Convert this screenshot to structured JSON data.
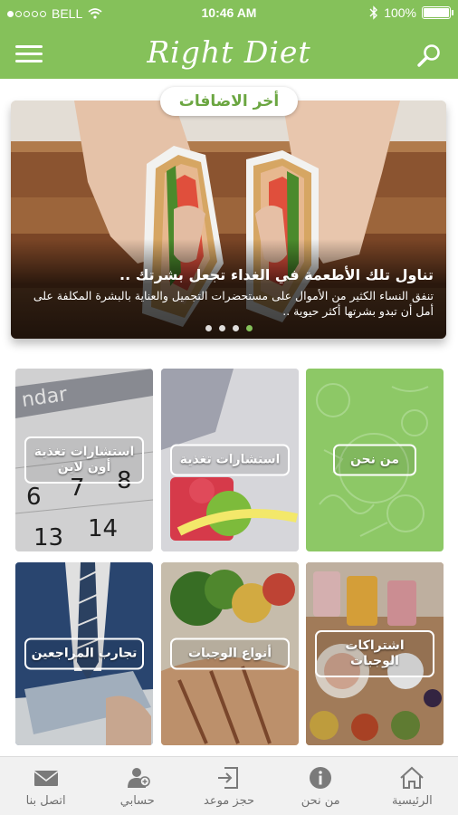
{
  "status_bar": {
    "carrier": "BELL",
    "time": "10:46 AM",
    "battery": "100%",
    "signal_dots_filled": 1,
    "signal_dots_total": 5
  },
  "header": {
    "app_title": "Right Diet",
    "menu_icon": "hamburger-menu-icon",
    "search_icon": "search-icon"
  },
  "colors": {
    "brand_green": "#85c15a",
    "pill_text": "#6ba641",
    "tab_text": "#707070"
  },
  "latest": {
    "section_title": "أخر الاضافات",
    "slide_title": "تناول تلك الأطعمة في الغداء تجعل بشرتك ..",
    "slide_text": "تنفق النساء الكثير من الأموال على مستحضرات التجميل والعناية بالبشرة المكلفة على أمل أن تبدو بشرتها أكثر حيوية ..",
    "slide_count": 4,
    "active_slide": 4
  },
  "tiles": [
    {
      "label": "من نحن",
      "icon": "about-tile-image"
    },
    {
      "label": "استشارات تغذية",
      "icon": "nutrition-consult-tile-image"
    },
    {
      "label": "استشارات تغذية أون لاين",
      "icon": "online-consult-tile-image"
    },
    {
      "label": "اشتراكات الوجبات",
      "icon": "meal-subscription-tile-image"
    },
    {
      "label": "أنواع الوجبات",
      "icon": "meal-types-tile-image"
    },
    {
      "label": "تجارب المراجعين",
      "icon": "reviews-tile-image"
    }
  ],
  "tabs": [
    {
      "label": "الرئيسية",
      "icon": "home-icon"
    },
    {
      "label": "من نحن",
      "icon": "info-icon"
    },
    {
      "label": "حجز موعد",
      "icon": "booking-icon"
    },
    {
      "label": "حسابي",
      "icon": "account-icon"
    },
    {
      "label": "اتصل بنا",
      "icon": "mail-icon"
    }
  ]
}
